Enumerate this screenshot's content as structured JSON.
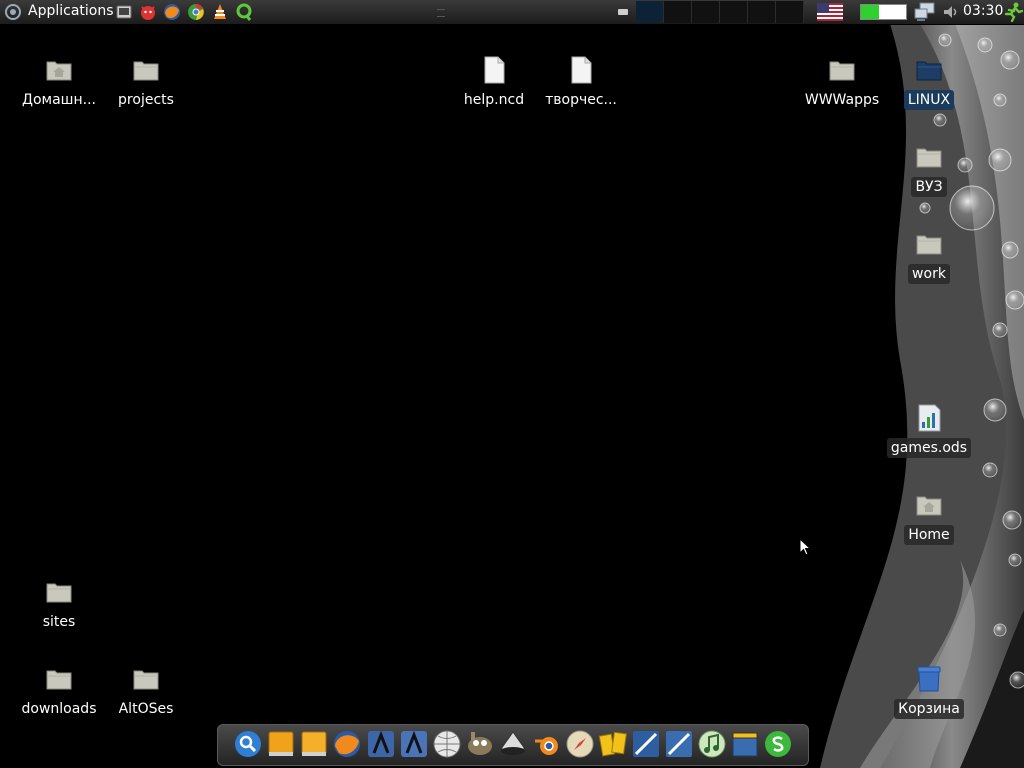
{
  "colors": {
    "panel": "#2a2a2a",
    "desktop": "#000000",
    "folder": "#c9c8bd",
    "accent": "#1b3b5c"
  },
  "top_panel": {
    "menu_label": "Applications",
    "menu_icon": "distro-logo-icon",
    "launchers": [
      "system-monitor-icon",
      "red-devil-icon",
      "firefox-icon",
      "chrome-icon",
      "vlc-icon",
      "qutim-icon"
    ],
    "workspaces": 6,
    "active_workspace": 1,
    "tray": [
      "us-flag-icon",
      "battery-icon",
      "network-icon",
      "volume-icon"
    ],
    "clock": "03:30",
    "tray_end_icon": "running-man-icon"
  },
  "desktop": {
    "icons": [
      {
        "name": "home-folder",
        "label": "Домашн...",
        "icon": "home-folder-icon"
      },
      {
        "name": "projects",
        "label": "projects",
        "icon": "folder-icon"
      },
      {
        "name": "help-ncd",
        "label": "help.ncd",
        "icon": "document-icon"
      },
      {
        "name": "tvorches",
        "label": "творчес...",
        "icon": "document-icon"
      },
      {
        "name": "wwwapps",
        "label": "WWWapps",
        "icon": "folder-icon"
      },
      {
        "name": "linux",
        "label": "LINUX",
        "icon": "folder-icon"
      },
      {
        "name": "vuz",
        "label": "ВУЗ",
        "icon": "folder-icon"
      },
      {
        "name": "work",
        "label": "work",
        "icon": "folder-icon"
      },
      {
        "name": "games-ods",
        "label": "games.ods",
        "icon": "spreadsheet-icon"
      },
      {
        "name": "home",
        "label": "Home",
        "icon": "home-folder-icon"
      },
      {
        "name": "sites",
        "label": "sites",
        "icon": "folder-icon"
      },
      {
        "name": "downloads",
        "label": "downloads",
        "icon": "folder-icon"
      },
      {
        "name": "altoses",
        "label": "AltOSes",
        "icon": "folder-icon"
      },
      {
        "name": "trash",
        "label": "Корзина",
        "icon": "trash-icon"
      }
    ]
  },
  "dock": {
    "items": [
      "search-icon",
      "drive-icon",
      "drive-icon",
      "firefox-icon",
      "app-icon",
      "app-icon",
      "globe-icon",
      "gimp-icon",
      "inkscape-icon",
      "blender-icon",
      "compass-icon",
      "office-icon",
      "app-icon",
      "app-icon",
      "music-icon",
      "video-icon",
      "skype-icon"
    ]
  }
}
